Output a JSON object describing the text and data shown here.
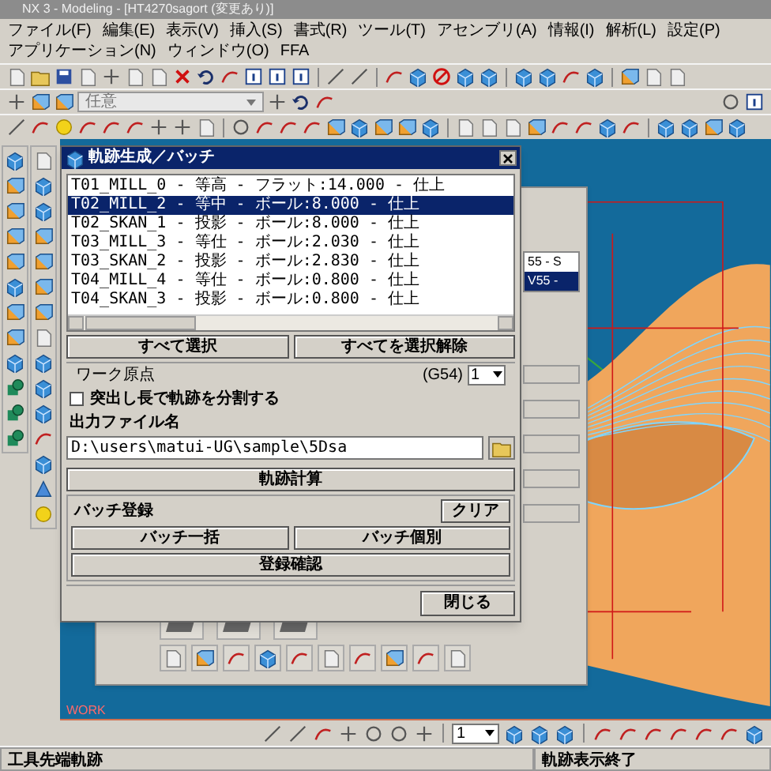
{
  "window": {
    "title": "NX 3 - Modeling - [HT4270sagort (変更あり)]"
  },
  "menu": [
    "ファイル(F)",
    "編集(E)",
    "表示(V)",
    "挿入(S)",
    "書式(R)",
    "ツール(T)",
    "アセンブリ(A)",
    "情報(I)",
    "解析(L)",
    "設定(P)",
    "アプリケーション(N)",
    "ウィンドウ(O)",
    "FFA"
  ],
  "toolbar": {
    "filter": "任意"
  },
  "dialog": {
    "title": "軌跡生成／バッチ",
    "operations": [
      {
        "label": "T01_MILL_0 - 等高 - フラット:14.000 - 仕上",
        "selected": false
      },
      {
        "label": "T02_MILL_2 - 等中 - ボール:8.000 - 仕上",
        "selected": true
      },
      {
        "label": "T02_SKAN_1 - 投影 - ボール:8.000 - 仕上",
        "selected": false
      },
      {
        "label": "T03_MILL_3 - 等仕 - ボール:2.030 - 仕上",
        "selected": false
      },
      {
        "label": "T03_SKAN_2 - 投影 - ボール:2.830 - 仕上",
        "selected": false
      },
      {
        "label": "T04_MILL_4 - 等仕 - ボール:0.800 - 仕上",
        "selected": false
      },
      {
        "label": "T04_SKAN_3 - 投影 - ボール:0.800 - 仕上",
        "selected": false
      }
    ],
    "select_all": "すべて選択",
    "deselect_all": "すべてを選択解除",
    "work_origin": {
      "label": "ワーク原点",
      "code": "(G54)",
      "value": "1"
    },
    "split_option": {
      "label": "突出し長で軌跡を分割する",
      "checked": false
    },
    "output": {
      "label": "出力ファイル名",
      "value": "D:\\users\\matui-UG\\sample\\5Dsa"
    },
    "compute": "軌跡計算",
    "batch": {
      "label": "バッチ登録",
      "clear": "クリア",
      "all": "バッチ一括",
      "individual": "バッチ個別",
      "confirm": "登録確認"
    },
    "close": "閉じる"
  },
  "back_panel": {
    "rows": [
      {
        "text": "55 - S",
        "selected": false
      },
      {
        "text": "V55 -",
        "selected": true
      }
    ]
  },
  "viewport": {
    "label": "WORK"
  },
  "bottom_toolbar": {
    "layer": "1"
  },
  "status_bar": {
    "left": "工具先端軌跡",
    "right": "軌跡表示終了"
  }
}
